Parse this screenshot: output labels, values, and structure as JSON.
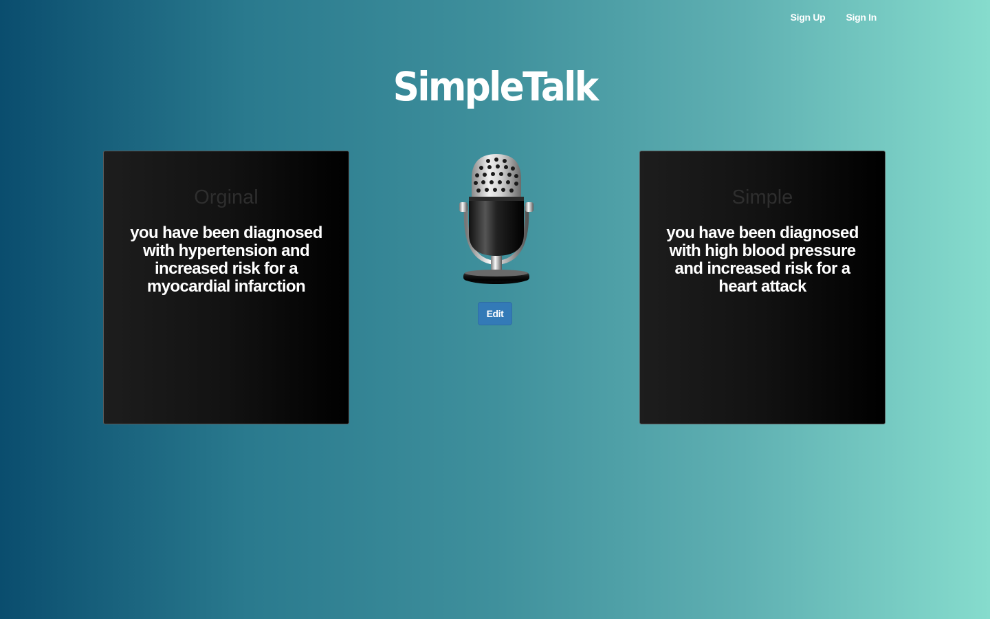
{
  "nav": {
    "sign_up": "Sign Up",
    "sign_in": "Sign In"
  },
  "logo": "SimpleTalk",
  "original_card": {
    "title": "Orginal",
    "text": "you have been diagnosed with hypertension and increased risk for a myocardial infarction"
  },
  "simple_card": {
    "title": "Simple",
    "text": "you have been diagnosed with high blood pressure and increased risk for a heart attack"
  },
  "microphone": {
    "icon": "microphone-icon"
  },
  "edit_button": "Edit",
  "colors": {
    "gradient_start": "#0a4d6e",
    "gradient_end": "#86dccd",
    "button": "#337ab7",
    "card_bg": "#121212"
  }
}
